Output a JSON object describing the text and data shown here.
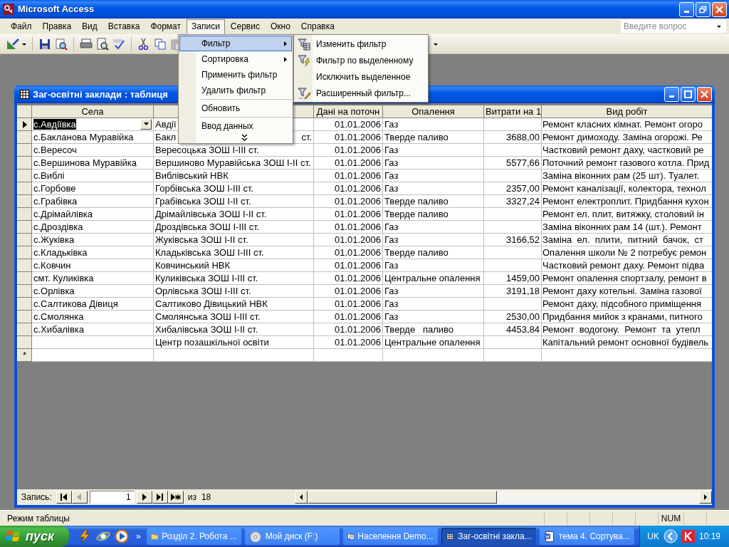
{
  "window": {
    "title": "Microsoft Access"
  },
  "menu_bar": [
    {
      "label": "Файл",
      "selected": false
    },
    {
      "label": "Правка",
      "selected": false
    },
    {
      "label": "Вид",
      "selected": false
    },
    {
      "label": "Вставка",
      "selected": false
    },
    {
      "label": "Формат",
      "selected": false
    },
    {
      "label": "Записи",
      "selected": true
    },
    {
      "label": "Сервис",
      "selected": false
    },
    {
      "label": "Окно",
      "selected": false
    },
    {
      "label": "Справка",
      "selected": false
    }
  ],
  "help_box": {
    "placeholder": "Введите вопрос"
  },
  "open_menu": {
    "items": [
      {
        "kind": "item",
        "label": "Фильтр",
        "submenu": true,
        "selected": true
      },
      {
        "kind": "item",
        "label": "Сортировка",
        "submenu": true,
        "selected": false
      },
      {
        "kind": "item",
        "label": "Применить фильтр",
        "submenu": false,
        "selected": false
      },
      {
        "kind": "item",
        "label": "Удалить фильтр",
        "submenu": false,
        "selected": false
      },
      {
        "kind": "separator"
      },
      {
        "kind": "item",
        "label": "Обновить",
        "submenu": false,
        "selected": false
      },
      {
        "kind": "separator"
      },
      {
        "kind": "item",
        "label": "Ввод данных",
        "submenu": false,
        "selected": false
      },
      {
        "kind": "more"
      }
    ]
  },
  "submenu": {
    "items": [
      {
        "kind": "form-filter",
        "label": "Изменить фильтр"
      },
      {
        "kind": "selection-filter",
        "label": "Фильтр по выделенному"
      },
      {
        "kind": "plain",
        "label": "Исключить выделенное"
      },
      {
        "kind": "advanced-filter",
        "label": "Расширенный фильтр..."
      }
    ]
  },
  "child_window": {
    "title": "Заг-освітні заклади : таблиця"
  },
  "table": {
    "columns": [
      {
        "label": "Села",
        "kind": "text"
      },
      {
        "kind": "text"
      },
      {
        "label": "Дані на поточн",
        "kind": "date"
      },
      {
        "label": "Опалення",
        "kind": "text"
      },
      {
        "label": "Витрати на 1",
        "kind": "number"
      },
      {
        "label": "Вид робіт",
        "kind": "text"
      }
    ],
    "rows": [
      {
        "selected": true,
        "cells": [
          "с.Авдіївка",
          "Авдії",
          "01.01.2006",
          "Газ",
          null,
          "Ремонт класних кімнат. Ремонт огоро"
        ]
      },
      {
        "selected": false,
        "cells": [
          "с.Бакланова Муравійка",
          {
            "start": "Бакл",
            "end": "ст."
          },
          "01.01.2006",
          "Тверде паливо",
          "3688,00",
          "Ремонт димоходу. Заміна огорожі. Ре"
        ]
      },
      {
        "selected": false,
        "cells": [
          "с.Вересоч",
          "Вересоцька ЗОШ І-ІІІ ст.",
          "01.01.2006",
          "Газ",
          null,
          "Частковий ремонт даху, частковий ре"
        ]
      },
      {
        "selected": false,
        "cells": [
          "с.Вершинова Муравійка",
          "Вершиново Муравійська ЗОШ І-ІІ ст.",
          "01.01.2006",
          "Газ",
          "5577,66",
          "Поточний ремонт газового котла. Прид"
        ]
      },
      {
        "selected": false,
        "cells": [
          "с.Виблі",
          "Виблівський НВК",
          "01.01.2006",
          "Газ",
          null,
          "Заміна віконних рам (25 шт). Туалет."
        ]
      },
      {
        "selected": false,
        "cells": [
          "с.Горбове",
          "Горбівська ЗОШ І-ІІІ ст.",
          "01.01.2006",
          "Газ",
          "2357,00",
          "Ремонт каналізації, колектора, технол"
        ]
      },
      {
        "selected": false,
        "cells": [
          "с.Грабівка",
          "Грабівська ЗОШ І-ІІ ст.",
          "01.01.2006",
          "Тверде паливо",
          "3327,24",
          "Ремонт електроплит. Придбання кухон"
        ]
      },
      {
        "selected": false,
        "cells": [
          "с.Дрімайлівка",
          "Дрімайлівська ЗОШ І-ІІ ст.",
          "01.01.2006",
          "Тверде паливо",
          null,
          "Ремонт ел. плит, витяжку, столовий ін"
        ]
      },
      {
        "selected": false,
        "cells": [
          "с.Дроздівка",
          "Дроздівська ЗОШ І-ІІІ ст.",
          "01.01.2006",
          "Газ",
          null,
          "Заміна віконних рам 14 (шт.). Ремонт"
        ]
      },
      {
        "selected": false,
        "cells": [
          "с.Жуківка",
          "Жуківська ЗОШ І-ІІ ст.",
          "01.01.2006",
          "Газ",
          "3166,52",
          "Заміна  ел.  плити,  питний  бачок,  ст"
        ]
      },
      {
        "selected": false,
        "cells": [
          "с.Кладьківка",
          "Кладьківська ЗОШ І-ІІІ ст.",
          "01.01.2006",
          "Тверде паливо",
          null,
          "Опалення школи № 2 потребує ремон"
        ]
      },
      {
        "selected": false,
        "cells": [
          "с.Ковчин",
          "Ковчинський НВК",
          "01.01.2006",
          "Газ",
          null,
          "Частковий ремонт даху. Ремонт підва"
        ]
      },
      {
        "selected": false,
        "cells": [
          "смт. Куликівка",
          "Куликівська ЗОШ І-ІІІ ст.",
          "01.01.2006",
          "Центральне опалення",
          "1459,00",
          "Ремонт опалення спортзалу, ремонт в"
        ]
      },
      {
        "selected": false,
        "cells": [
          "с.Орлівка",
          "Орлівська ЗОШ І-ІІІ ст.",
          "01.01.2006",
          "Газ",
          "3191,18",
          "Ремонт даху котельні. Заміна газової"
        ]
      },
      {
        "selected": false,
        "cells": [
          "с.Салтикова Дівиця",
          "Салтиково Дівицький НВК",
          "01.01.2006",
          "Газ",
          null,
          "Ремонт даху, підсобного приміщення"
        ]
      },
      {
        "selected": false,
        "cells": [
          "с.Смолянка",
          "Смолянська ЗОШ І-ІІІ ст.",
          "01.01.2006",
          "Газ",
          "2530,00",
          "Придбання мийок з кранами, питного"
        ]
      },
      {
        "selected": false,
        "cells": [
          "с.Хибалівка",
          "Хибалівська ЗОШ І-ІІ ст.",
          "01.01.2006",
          "Тверде   паливо",
          "4453,84",
          "Ремонт  водогону.  Ремонт  та  утепл"
        ]
      },
      {
        "selected": false,
        "cells": [
          null,
          "Центр позашкільної освіти",
          "01.01.2006",
          "Центральне опалення",
          null,
          "Капітальний ремонт основної будівель"
        ]
      }
    ],
    "new_record_marker": "*"
  },
  "record_nav": {
    "label": "Запись:",
    "buttons_before": [
      {
        "kind": "first",
        "disabled": false
      },
      {
        "kind": "previous",
        "disabled": true
      }
    ],
    "current": "1",
    "buttons_after": [
      {
        "kind": "next",
        "disabled": false
      },
      {
        "kind": "last",
        "disabled": false
      },
      {
        "kind": "new",
        "disabled": false
      }
    ],
    "of_label": "из",
    "total": "18"
  },
  "status_bar": {
    "text": "Режим таблицы",
    "indicator": "NUM"
  },
  "taskbar": {
    "start_label": "пуск",
    "more": "»",
    "tasks": [
      {
        "kind": "folder",
        "label": "Розділ 2. Робота ...",
        "selected": false
      },
      {
        "kind": "disc",
        "label": "Мой диск (F:)",
        "selected": false
      },
      {
        "kind": "form",
        "label": "Населення Demo...",
        "selected": false
      },
      {
        "kind": "datasheet",
        "label": "Заг-освітні закла...",
        "selected": true
      },
      {
        "kind": "document",
        "label": "тема 4. Сортува...",
        "selected": false
      }
    ],
    "language": "UK",
    "clock": "10:19"
  }
}
